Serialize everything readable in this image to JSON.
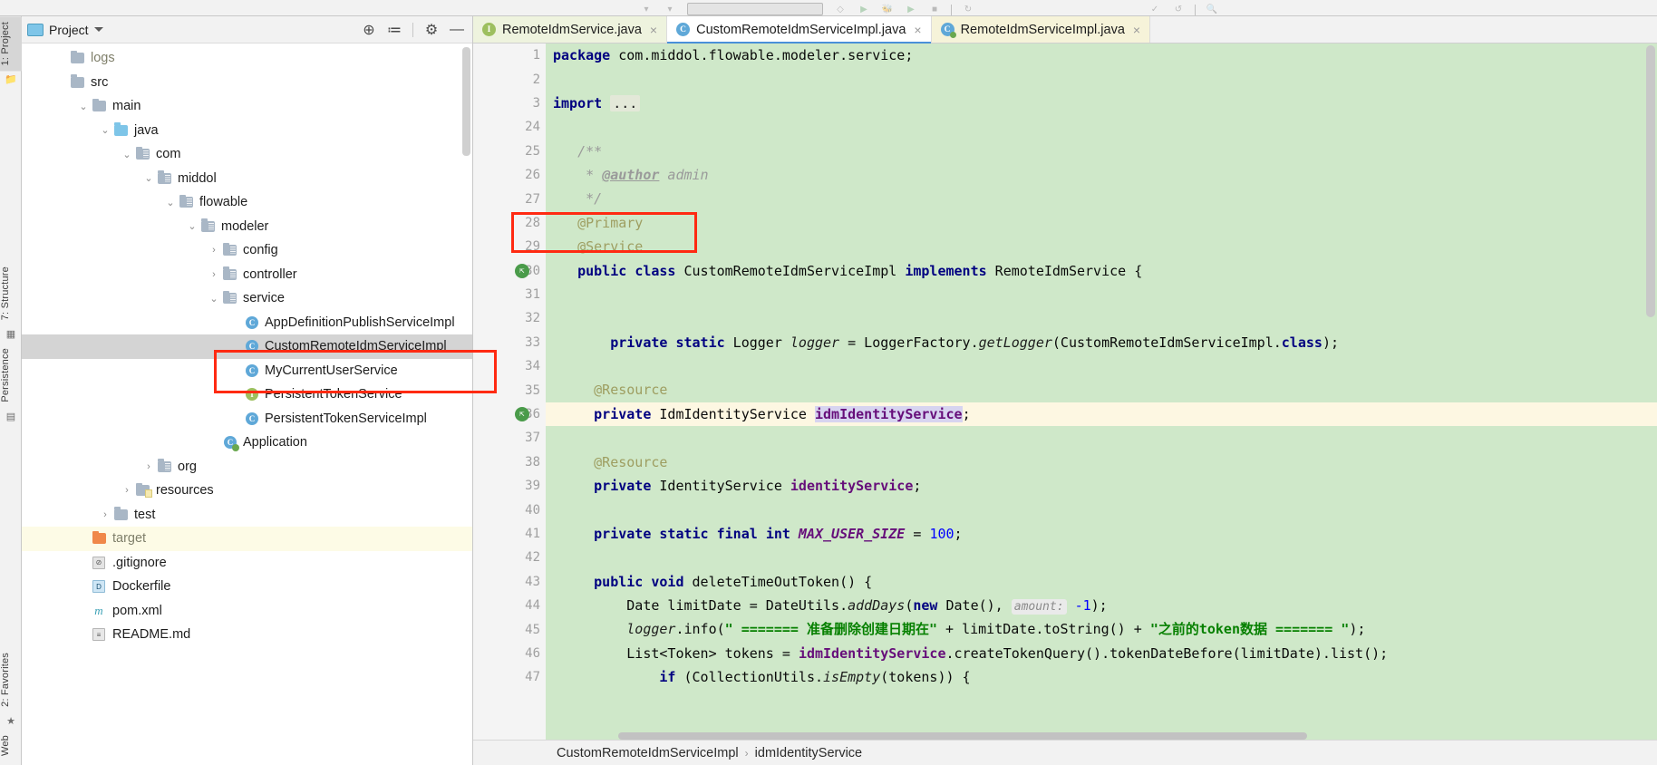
{
  "window": {
    "toolbar_hint": "run-configuration-toolbar"
  },
  "project_panel": {
    "title": "Project",
    "header_icons": [
      {
        "name": "locate-icon",
        "glyph": "⊕"
      },
      {
        "name": "collapse-all-icon",
        "glyph": "≔"
      },
      {
        "name": "settings-gear-icon",
        "glyph": "⚙"
      },
      {
        "name": "hide-panel-icon",
        "glyph": "—"
      }
    ],
    "tree": [
      {
        "label": "logs",
        "indent": 0,
        "arrow": "none",
        "icon": "folder-gray",
        "muted": true
      },
      {
        "label": "src",
        "indent": 0,
        "arrow": "none",
        "icon": "folder-gray",
        "muted": false
      },
      {
        "label": "main",
        "indent": 1,
        "arrow": "expanded",
        "icon": "folder-gray",
        "muted": false
      },
      {
        "label": "java",
        "indent": 2,
        "arrow": "expanded",
        "icon": "folder-blue",
        "muted": false
      },
      {
        "label": "com",
        "indent": 3,
        "arrow": "expanded",
        "icon": "folder-pkg",
        "muted": false
      },
      {
        "label": "middol",
        "indent": 4,
        "arrow": "expanded",
        "icon": "folder-pkg",
        "muted": false
      },
      {
        "label": "flowable",
        "indent": 5,
        "arrow": "expanded",
        "icon": "folder-pkg",
        "muted": false
      },
      {
        "label": "modeler",
        "indent": 6,
        "arrow": "expanded",
        "icon": "folder-pkg",
        "muted": false
      },
      {
        "label": "config",
        "indent": 7,
        "arrow": "collapsed",
        "icon": "folder-pkg",
        "muted": false
      },
      {
        "label": "controller",
        "indent": 7,
        "arrow": "collapsed",
        "icon": "folder-pkg",
        "muted": false
      },
      {
        "label": "service",
        "indent": 7,
        "arrow": "expanded",
        "icon": "folder-pkg",
        "muted": false
      },
      {
        "label": "AppDefinitionPublishServiceImpl",
        "indent": 8,
        "arrow": "none",
        "icon": "class",
        "muted": false
      },
      {
        "label": "CustomRemoteIdmServiceImpl",
        "indent": 8,
        "arrow": "none",
        "icon": "class",
        "muted": false,
        "selected": true
      },
      {
        "label": "MyCurrentUserService",
        "indent": 8,
        "arrow": "none",
        "icon": "class",
        "muted": false
      },
      {
        "label": "PersistentTokenService",
        "indent": 8,
        "arrow": "none",
        "icon": "interface",
        "muted": false
      },
      {
        "label": "PersistentTokenServiceImpl",
        "indent": 8,
        "arrow": "none",
        "icon": "class",
        "muted": false
      },
      {
        "label": "Application",
        "indent": 7,
        "arrow": "none",
        "icon": "app-class",
        "muted": false
      },
      {
        "label": "org",
        "indent": 4,
        "arrow": "collapsed",
        "icon": "folder-pkg",
        "muted": false
      },
      {
        "label": "resources",
        "indent": 3,
        "arrow": "collapsed",
        "icon": "folder-res",
        "muted": false
      },
      {
        "label": "test",
        "indent": 2,
        "arrow": "collapsed",
        "icon": "folder-gray",
        "muted": false
      },
      {
        "label": "target",
        "indent": 1,
        "arrow": "none",
        "icon": "folder-orange",
        "muted": true,
        "library": true
      },
      {
        "label": ".gitignore",
        "indent": 1,
        "arrow": "none",
        "icon": "file-git",
        "muted": false
      },
      {
        "label": "Dockerfile",
        "indent": 1,
        "arrow": "none",
        "icon": "file-docker",
        "muted": false
      },
      {
        "label": "pom.xml",
        "indent": 1,
        "arrow": "none",
        "icon": "file-maven",
        "muted": false
      },
      {
        "label": "README.md",
        "indent": 1,
        "arrow": "none",
        "icon": "file-md",
        "muted": false
      }
    ]
  },
  "left_rail": {
    "top": [
      {
        "label": "1: Project",
        "active": true
      }
    ],
    "mid": [
      {
        "label": "7: Structure"
      },
      {
        "label": "Persistence"
      }
    ],
    "bottom": [
      {
        "label": "2: Favorites"
      }
    ],
    "web_label": "Web"
  },
  "editor": {
    "tabs": [
      {
        "label": "RemoteIdmService.java",
        "badge": "interface",
        "state": "green",
        "close": "×"
      },
      {
        "label": "CustomRemoteIdmServiceImpl.java",
        "badge": "class",
        "state": "active",
        "close": "×"
      },
      {
        "label": "RemoteIdmServiceImpl.java",
        "badge": "app-class",
        "state": "yellow",
        "close": "×"
      }
    ],
    "line_numbers": [
      "1",
      "2",
      "3",
      "24",
      "25",
      "26",
      "27",
      "28",
      "29",
      "30",
      "31",
      "32",
      "33",
      "34",
      "35",
      "36",
      "37",
      "38",
      "39",
      "40",
      "41",
      "42",
      "43",
      "44",
      "45",
      "46",
      "47"
    ],
    "code": {
      "l1": {
        "kw1": "package",
        "rest": " com.middol.flowable.modeler.service;"
      },
      "l3": {
        "kw1": "import",
        "folded": "..."
      },
      "l25": {
        "text": "/**"
      },
      "l26": {
        "star": "* ",
        "tag": "@author",
        "val": " admin"
      },
      "l27": {
        "text": "*/"
      },
      "l28": {
        "text": "@Primary"
      },
      "l29": {
        "text": "@Service"
      },
      "l30": {
        "kw1": "public",
        "kw2": "class",
        "name": " CustomRemoteIdmServiceImpl ",
        "kw3": "implements",
        "iface": " RemoteIdmService {"
      },
      "l33": {
        "kw1": "private",
        "kw2": "static",
        "type": " Logger ",
        "field": "logger",
        "rest": " = LoggerFactory.",
        "call": "getLogger",
        "args": "(CustomRemoteIdmServiceImpl.",
        "kwclass": "class",
        "tail": ");"
      },
      "l35": {
        "text": "@Resource"
      },
      "l36": {
        "kw1": "private",
        "type": " IdmIdentityService ",
        "field": "idmIdentityService",
        "tail": ";"
      },
      "l38": {
        "text": "@Resource"
      },
      "l39": {
        "kw1": "private",
        "type": " IdentityService ",
        "field": "identityService",
        "tail": ";"
      },
      "l41": {
        "kw1": "private",
        "kw2": "static",
        "kw3": "final",
        "kw4": "int",
        "const": " MAX_USER_SIZE ",
        "eq": "= ",
        "num": "100",
        "tail": ";"
      },
      "l43": {
        "kw1": "public",
        "kw2": "void",
        "method": " deleteTimeOutToken() {"
      },
      "l44": {
        "pre": "Date limitDate = DateUtils.",
        "call": "addDays",
        "p1": "(",
        "kw": "new",
        "p2": " Date(), ",
        "hint": "amount:",
        "num": " -1",
        "tail": ");"
      },
      "l45": {
        "logger": "logger",
        "dot": ".info(",
        "str": "\" ======= 准备删除创建日期在\"",
        "mid": " + limitDate.toString() + ",
        "str2": "\"之前的token数据 ======= \"",
        "tail": ");"
      },
      "l46": {
        "pre": "List<Token> tokens = ",
        "field": "idmIdentityService",
        "mid": ".createTokenQuery().tokenDateBefore(limitDate).list();"
      },
      "l47": {
        "kw": "if",
        "pre": " (CollectionUtils.",
        "call": "isEmpty",
        "tail": "(tokens)) {"
      }
    },
    "gutter_marks": [
      {
        "line": "30",
        "type": "implemented-by-marker"
      },
      {
        "line": "36",
        "type": "implemented-by-marker"
      }
    ]
  },
  "breadcrumb": {
    "class": "CustomRemoteIdmServiceImpl",
    "separator": "›",
    "member": "idmIdentityService"
  },
  "annotations": {
    "tree_highlight_target": "CustomRemoteIdmServiceImpl",
    "code_highlight_target": "@Primary",
    "highlight_color": "#ff2a12"
  },
  "colors": {
    "code_background": "#cfe8c9",
    "caret_line": "#fdf7e2",
    "selection": "#d7d4f0",
    "keyword": "#000080",
    "string": "#068000",
    "field": "#660e7a",
    "annotation": "#9e9e61"
  }
}
